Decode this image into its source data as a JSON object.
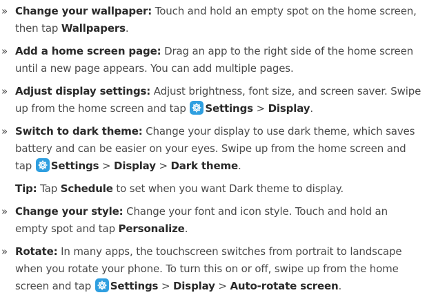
{
  "bullet": "»",
  "items": [
    {
      "title": "Change your wallpaper:",
      "text1": " Touch and hold an empty spot on the home screen, then tap ",
      "bold1": "Wallpapers",
      "text2": "."
    },
    {
      "title": "Add a home screen page:",
      "text1": " Drag an app to the right side of the home screen until a new page appears. You can add multiple pages."
    },
    {
      "title": "Adjust display settings:",
      "text1": " Adjust brightness, font size, and screen saver. Swipe up from the home screen and tap ",
      "icon": "settings-icon",
      "bold1": "Settings",
      "sep1": " > ",
      "bold2": "Display",
      "text2": "."
    },
    {
      "title": "Switch to dark theme:",
      "text1": " Change your display to use dark theme, which saves battery and can be easier on your eyes. Swipe up from the home screen and tap ",
      "icon": "settings-icon",
      "bold1": "Settings",
      "sep1": " > ",
      "bold2": "Display",
      "sep2": " > ",
      "bold3": "Dark theme",
      "text2": "."
    },
    {
      "title": "Change your style:",
      "text1": " Change your font and icon style. Touch and hold an empty spot and tap ",
      "bold1": "Personalize",
      "text2": "."
    },
    {
      "title": "Rotate:",
      "text1": " In many apps, the touchscreen switches from portrait to landscape when you rotate your phone. To turn this on or off, swipe up from the home screen and tap ",
      "icon": "settings-icon",
      "bold1": "Settings",
      "sep1": " > ",
      "bold2": "Display",
      "sep2": " > ",
      "bold3": "Auto-rotate screen",
      "text2": "."
    }
  ],
  "tip": {
    "label": "Tip:",
    "text1": " Tap ",
    "bold1": "Schedule",
    "text2": " to set when you want Dark theme to display."
  },
  "colors": {
    "text": "#4a4a4a",
    "bold": "#2a2a2a",
    "settings_icon_bg": "#2f9fe0"
  }
}
